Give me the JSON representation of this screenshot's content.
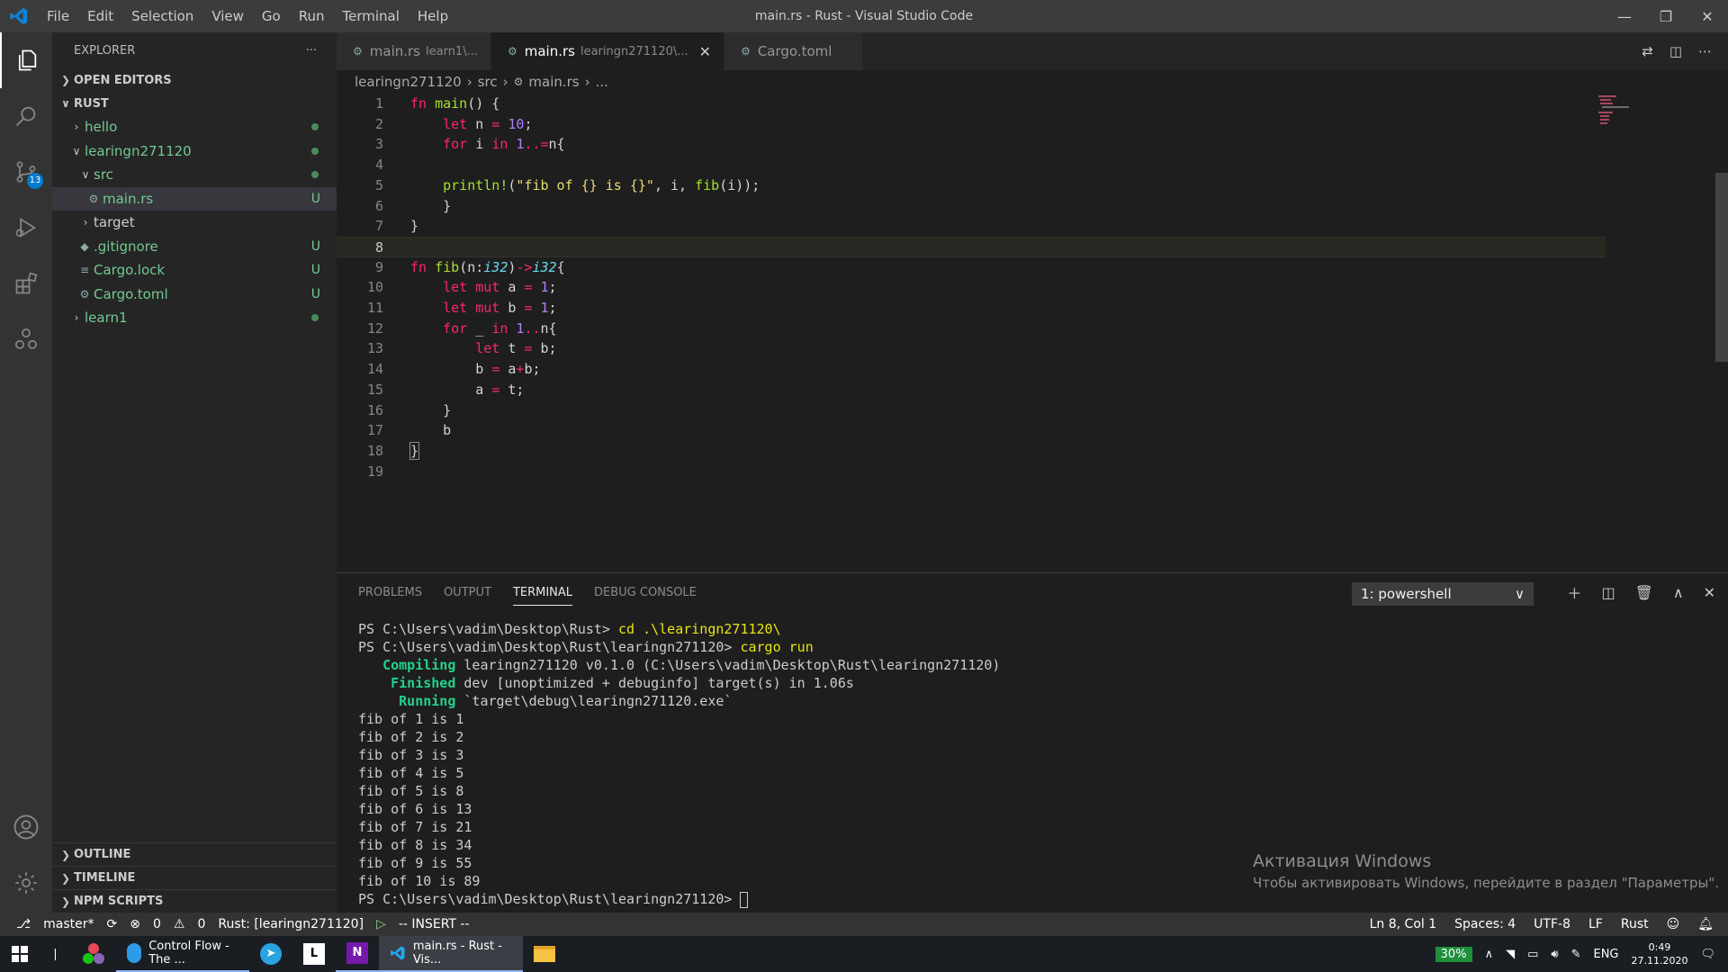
{
  "window": {
    "title": "main.rs - Rust - Visual Studio Code",
    "menu": [
      "File",
      "Edit",
      "Selection",
      "View",
      "Go",
      "Run",
      "Terminal",
      "Help"
    ]
  },
  "activity": {
    "scm_badge": "13"
  },
  "sidebar": {
    "title": "EXPLORER",
    "more": "···",
    "open_editors": "OPEN EDITORS",
    "root": "RUST",
    "tree": [
      {
        "label": "hello",
        "status": ""
      },
      {
        "label": "learingn271120",
        "status": ""
      },
      {
        "label": "src",
        "status": ""
      },
      {
        "label": "main.rs",
        "status": "U"
      },
      {
        "label": "target",
        "status": ""
      },
      {
        "label": ".gitignore",
        "status": "U"
      },
      {
        "label": "Cargo.lock",
        "status": "U"
      },
      {
        "label": "Cargo.toml",
        "status": "U"
      },
      {
        "label": "learn1",
        "status": ""
      }
    ],
    "bottom": [
      "OUTLINE",
      "TIMELINE",
      "NPM SCRIPTS"
    ]
  },
  "tabs": [
    {
      "label": "main.rs",
      "sub": "learn1\\..."
    },
    {
      "label": "main.rs",
      "sub": "learingn271120\\..."
    },
    {
      "label": "Cargo.toml",
      "sub": ""
    }
  ],
  "breadcrumb": [
    "learingn271120",
    "src",
    "main.rs",
    "..."
  ],
  "code": {
    "line_numbers": [
      "1",
      "2",
      "3",
      "4",
      "5",
      "6",
      "7",
      "8",
      "9",
      "10",
      "11",
      "12",
      "13",
      "14",
      "15",
      "16",
      "17",
      "18",
      "19"
    ]
  },
  "panel": {
    "tabs": [
      "PROBLEMS",
      "OUTPUT",
      "TERMINAL",
      "DEBUG CONSOLE"
    ],
    "terminal_select": "1: powershell",
    "terminal": {
      "l1": "PS C:\\Users\\vadim\\Desktop\\Rust> ",
      "l1cmd": "cd .\\learingn271120\\",
      "l2": "PS C:\\Users\\vadim\\Desktop\\Rust\\learingn271120> ",
      "l2cmd": "cargo run",
      "compiling_kw": "   Compiling",
      "compiling": " learingn271120 v0.1.0 (C:\\Users\\vadim\\Desktop\\Rust\\learingn271120)",
      "finished_kw": "    Finished",
      "finished": " dev [unoptimized + debuginfo] target(s) in 1.06s",
      "running_kw": "     Running",
      "running": " `target\\debug\\learingn271120.exe`",
      "output": [
        "fib of 1 is 1",
        "fib of 2 is 2",
        "fib of 3 is 3",
        "fib of 4 is 5",
        "fib of 5 is 8",
        "fib of 6 is 13",
        "fib of 7 is 21",
        "fib of 8 is 34",
        "fib of 9 is 55",
        "fib of 10 is 89"
      ],
      "prompt": "PS C:\\Users\\vadim\\Desktop\\Rust\\learingn271120> "
    },
    "watermark_title": "Активация Windows",
    "watermark_text": "Чтобы активировать Windows, перейдите в раздел \"Параметры\"."
  },
  "status": {
    "branch": "master*",
    "errors": "0",
    "warnings": "0",
    "rust": "Rust: [learingn271120]",
    "mode": "-- INSERT --",
    "position": "Ln 8, Col 1",
    "spaces": "Spaces: 4",
    "encoding": "UTF-8",
    "eol": "LF",
    "language": "Rust"
  },
  "taskbar": {
    "edge": "Control Flow - The ...",
    "vscode": "main.rs - Rust - Vis...",
    "battery": "30%",
    "lang": "ENG",
    "time": "0:49",
    "date": "27.11.2020"
  },
  "colors": {
    "accent": "#007acc",
    "untracked": "#73c991",
    "keyword": "#f92672",
    "function": "#a6e22e",
    "number": "#ae81ff",
    "string": "#e6db74"
  }
}
